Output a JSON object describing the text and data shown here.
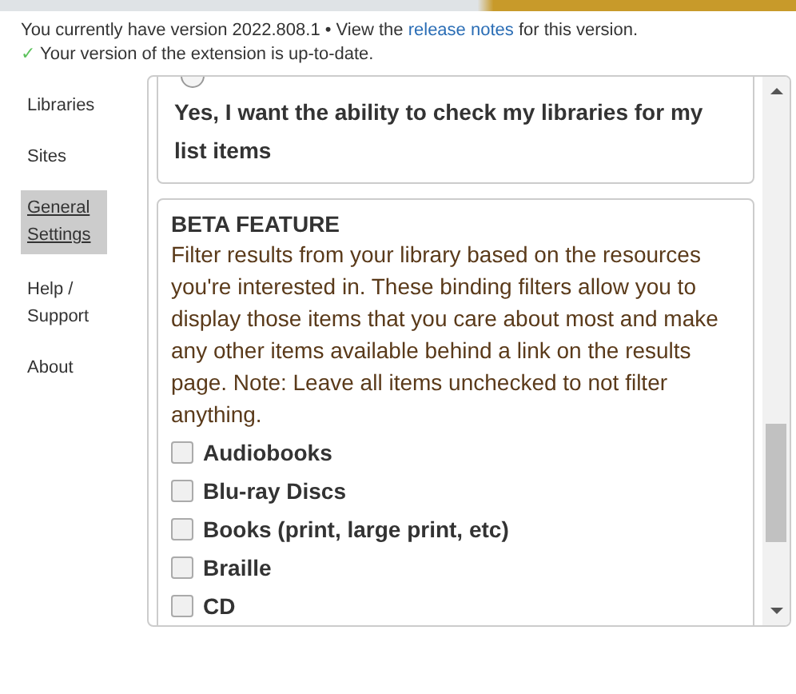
{
  "header": {
    "version_text": "You currently have version 2022.808.1 • View the",
    "release_link": "release notes",
    "version_suffix": "for this version.",
    "status_icon": "✓",
    "status_text": "Your version of the extension is up-to-date."
  },
  "sidebar": {
    "items": [
      {
        "label": "Libraries",
        "selected": false
      },
      {
        "label": "Sites",
        "selected": false
      },
      {
        "label": "General Settings",
        "selected": true
      },
      {
        "label": "Help / Support",
        "selected": false
      },
      {
        "label": "About",
        "selected": false
      }
    ]
  },
  "list_check_option": {
    "label": "Yes, I want the ability to check my libraries for my list items",
    "checked": false
  },
  "beta": {
    "title": "BETA FEATURE",
    "description": "Filter results from your library based on the resources you're interested in. These binding filters allow you to display those items that you care about most and make any other items available behind a link on the results page. Note: Leave all items unchecked to not filter anything.",
    "filters": [
      {
        "label": "Audiobooks",
        "checked": false
      },
      {
        "label": "Blu-ray Discs",
        "checked": false
      },
      {
        "label": "Books (print, large print, etc)",
        "checked": false
      },
      {
        "label": "Braille",
        "checked": false
      },
      {
        "label": "CD",
        "checked": false
      }
    ]
  }
}
